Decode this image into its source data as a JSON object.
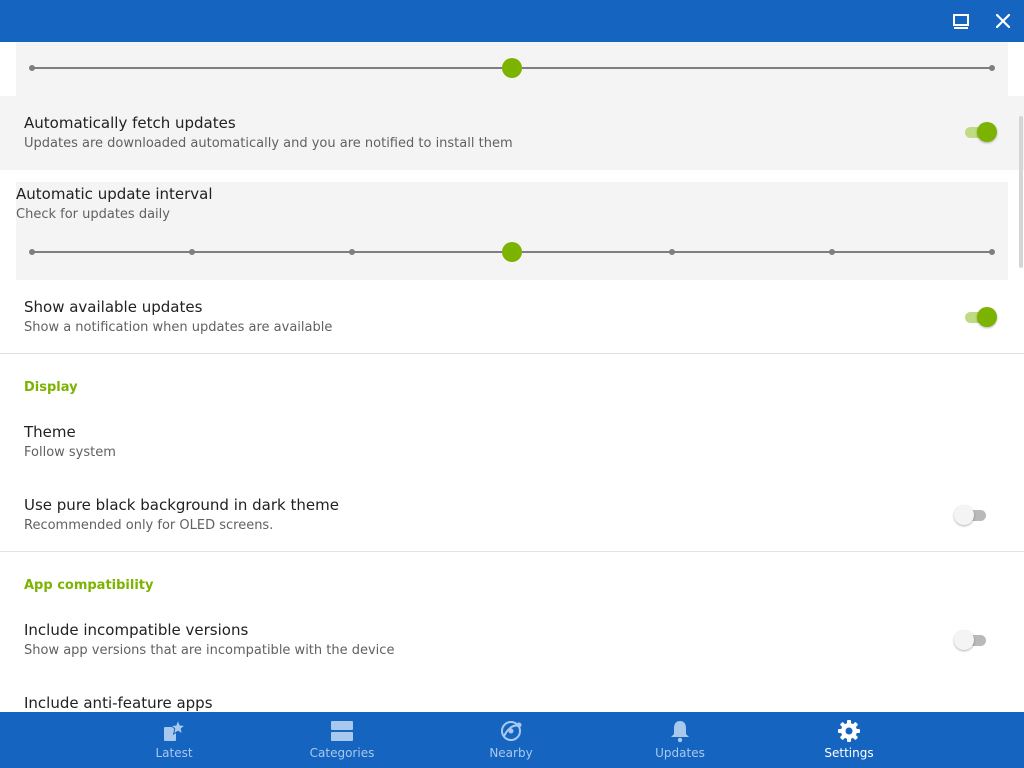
{
  "window": {
    "maximize_icon": "maximize-icon",
    "close_icon": "close-icon"
  },
  "updates": {
    "top_slider": {
      "fraction": 0.5
    },
    "auto_fetch": {
      "title": "Automatically fetch updates",
      "summary": "Updates are downloaded automatically and you are notified to install them",
      "enabled": true
    },
    "interval": {
      "title": "Automatic update interval",
      "summary": "Check for updates daily",
      "steps": 7,
      "selected_step": 3
    },
    "show_available": {
      "title": "Show available updates",
      "summary": "Show a notification when updates are available",
      "enabled": true
    }
  },
  "display": {
    "header": "Display",
    "theme": {
      "title": "Theme",
      "summary": "Follow system"
    },
    "pure_black": {
      "title": "Use pure black background in dark theme",
      "summary": "Recommended only for OLED screens.",
      "enabled": false
    }
  },
  "compat": {
    "header": "App compatibility",
    "incompatible": {
      "title": "Include incompatible versions",
      "summary": "Show app versions that are incompatible with the device",
      "enabled": false
    },
    "anti_feature": {
      "title": "Include anti-feature apps"
    }
  },
  "nav": {
    "items": [
      {
        "label": "Latest",
        "icon": "latest-icon",
        "active": false
      },
      {
        "label": "Categories",
        "icon": "categories-icon",
        "active": false
      },
      {
        "label": "Nearby",
        "icon": "nearby-icon",
        "active": false
      },
      {
        "label": "Updates",
        "icon": "updates-bell-icon",
        "active": false
      },
      {
        "label": "Settings",
        "icon": "settings-gear-icon",
        "active": true
      }
    ]
  },
  "colors": {
    "titlebar": "#1565c0",
    "accent": "#7cb300",
    "nav_inactive_label": "#a9c8ee",
    "nav_active_label": "#ffffff"
  }
}
